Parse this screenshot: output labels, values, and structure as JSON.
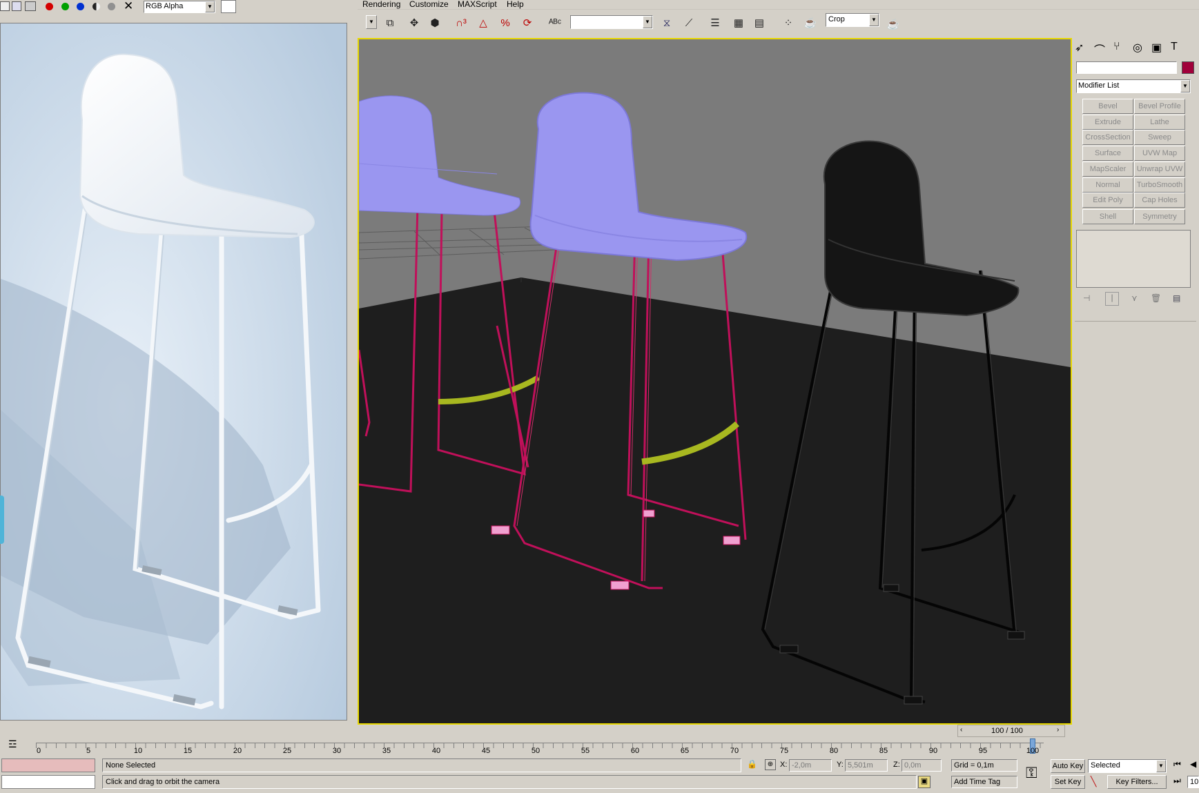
{
  "vfb": {
    "channel_select": "RGB Alpha",
    "color_dots": [
      "#d40000",
      "#00a000",
      "#0030d0",
      "#606060",
      "#909090"
    ],
    "clear_icon": "close-icon"
  },
  "menu": {
    "items": [
      "Rendering",
      "Customize",
      "MAXScript",
      "Help"
    ]
  },
  "toolbar": {
    "named_selection": "",
    "render_type": "Crop"
  },
  "command_panel": {
    "name_field": "",
    "object_color": "#a0003a",
    "modifier_list": "Modifier List",
    "buttons": [
      [
        "Bevel",
        "Bevel Profile"
      ],
      [
        "Extrude",
        "Lathe"
      ],
      [
        "CrossSection",
        "Sweep"
      ],
      [
        "Surface",
        "UVW Map"
      ],
      [
        "MapScaler",
        "Unwrap UVW"
      ],
      [
        "Normal",
        "TurboSmooth"
      ],
      [
        "Edit Poly",
        "Cap Holes"
      ],
      [
        "Shell",
        "Symmetry"
      ]
    ]
  },
  "time_slider": {
    "frame_display": "100 / 100",
    "ticks": [
      "0",
      "5",
      "10",
      "15",
      "20",
      "25",
      "30",
      "35",
      "40",
      "45",
      "50",
      "55",
      "60",
      "65",
      "70",
      "75",
      "80",
      "85",
      "90",
      "95",
      "100"
    ]
  },
  "status": {
    "selection": "None Selected",
    "prompt": "Click and drag to orbit the camera",
    "x_label": "X:",
    "x_value": "-2,0m",
    "y_label": "Y:",
    "y_value": "5,501m",
    "z_label": "Z:",
    "z_value": "0,0m",
    "grid": "Grid = 0,1m",
    "add_time_tag": "Add Time Tag",
    "auto_key": "Auto Key",
    "key_mode": "Selected",
    "set_key": "Set Key",
    "key_filters": "Key Filters...",
    "frame_field": "10"
  },
  "colors": {
    "chair_wire_magenta": "#c0105a",
    "chair_seat_violet": "#9a96f0",
    "footrest_yellow": "#a8b820",
    "viewport_bg": "#7b7b7b",
    "floor": "#1e1e1e",
    "render_bg": "#c4d4e4"
  }
}
